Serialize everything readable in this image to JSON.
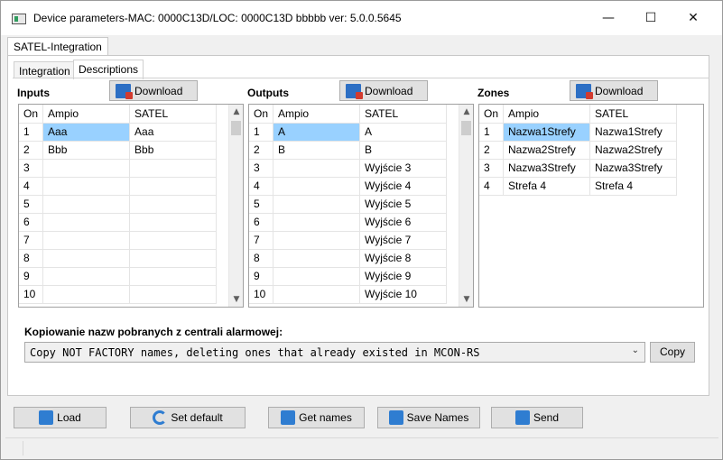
{
  "window": {
    "title": "Device parameters-MAC: 0000C13D/LOC: 0000C13D bbbbb ver: 5.0.0.5645",
    "controls": {
      "minimize": "—",
      "maximize": "☐",
      "close": "✕"
    }
  },
  "tabs": {
    "outer": "SATEL-Integration",
    "inner": [
      "Integration",
      "Descriptions"
    ]
  },
  "inputs": {
    "title": "Inputs",
    "download_label": "Download",
    "columns": [
      "On",
      "Ampio",
      "SATEL"
    ],
    "rows": [
      [
        "1",
        "Aaa",
        "Aaa"
      ],
      [
        "2",
        "Bbb",
        "Bbb"
      ],
      [
        "3",
        "",
        ""
      ],
      [
        "4",
        "",
        ""
      ],
      [
        "5",
        "",
        ""
      ],
      [
        "6",
        "",
        ""
      ],
      [
        "7",
        "",
        ""
      ],
      [
        "8",
        "",
        ""
      ],
      [
        "9",
        "",
        ""
      ],
      [
        "10",
        "",
        ""
      ]
    ]
  },
  "outputs": {
    "title": "Outputs",
    "download_label": "Download",
    "columns": [
      "On",
      "Ampio",
      "SATEL"
    ],
    "rows": [
      [
        "1",
        "A",
        "A"
      ],
      [
        "2",
        "B",
        "B"
      ],
      [
        "3",
        "",
        "Wyjście   3"
      ],
      [
        "4",
        "",
        "Wyjście   4"
      ],
      [
        "5",
        "",
        "Wyjście   5"
      ],
      [
        "6",
        "",
        "Wyjście   6"
      ],
      [
        "7",
        "",
        "Wyjście   7"
      ],
      [
        "8",
        "",
        "Wyjście   8"
      ],
      [
        "9",
        "",
        "Wyjście   9"
      ],
      [
        "10",
        "",
        "Wyjście   10"
      ]
    ]
  },
  "zones": {
    "title": "Zones",
    "download_label": "Download",
    "columns": [
      "On",
      "Ampio",
      "SATEL"
    ],
    "rows": [
      [
        "1",
        "Nazwa1Strefy",
        "Nazwa1Strefy"
      ],
      [
        "2",
        "Nazwa2Strefy",
        "Nazwa2Strefy"
      ],
      [
        "3",
        "Nazwa3Strefy",
        "Nazwa3Strefy"
      ],
      [
        "4",
        "Strefa  4",
        "Strefa  4"
      ]
    ]
  },
  "copy": {
    "label": "Kopiowanie nazw pobranych z centrali alarmowej:",
    "selected": "Copy NOT FACTORY names, deleting ones that already existed in MCON-RS",
    "button": "Copy"
  },
  "bottom_buttons": {
    "load": "Load",
    "set_default": "Set default",
    "get_names": "Get names",
    "save_names": "Save Names",
    "send": "Send"
  },
  "scroll_glyphs": {
    "up": "▲",
    "down": "▼",
    "combo": "⌄"
  },
  "colors": {
    "selection": "#99d1ff",
    "icon_blue": "#2f7dd1",
    "icon_red": "#d23b2f"
  }
}
